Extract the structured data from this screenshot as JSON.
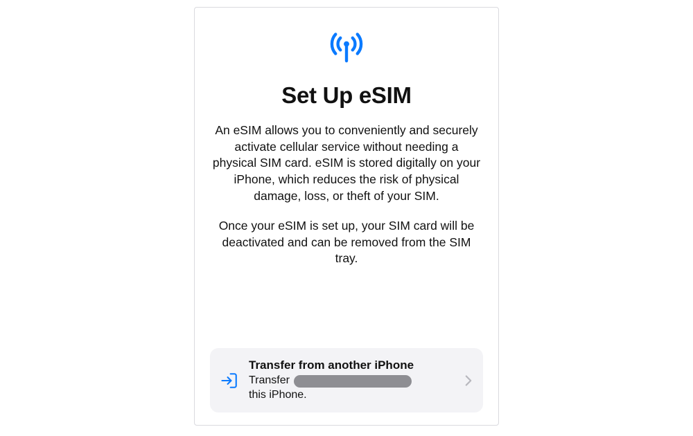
{
  "colors": {
    "accent": "#0a7aff",
    "chevron": "#b8b8be",
    "option_bg": "#f3f3f6",
    "redaction": "#8e8e93"
  },
  "header": {
    "icon_name": "cellular-antenna-icon",
    "title": "Set Up eSIM"
  },
  "body": {
    "paragraph1": "An eSIM allows you to conveniently and securely activate cellular service without needing a physical SIM card. eSIM is stored digitally on your iPhone, which reduces the risk of physical damage, loss, or theft of your SIM.",
    "paragraph2": "Once your eSIM is set up, your SIM card will be deactivated and can be removed from the SIM tray."
  },
  "options": {
    "transfer": {
      "icon_name": "transfer-in-icon",
      "title": "Transfer from another iPhone",
      "subtitle_prefix": "Transfer",
      "subtitle_redacted": true,
      "subtitle_suffix": "this iPhone."
    }
  }
}
